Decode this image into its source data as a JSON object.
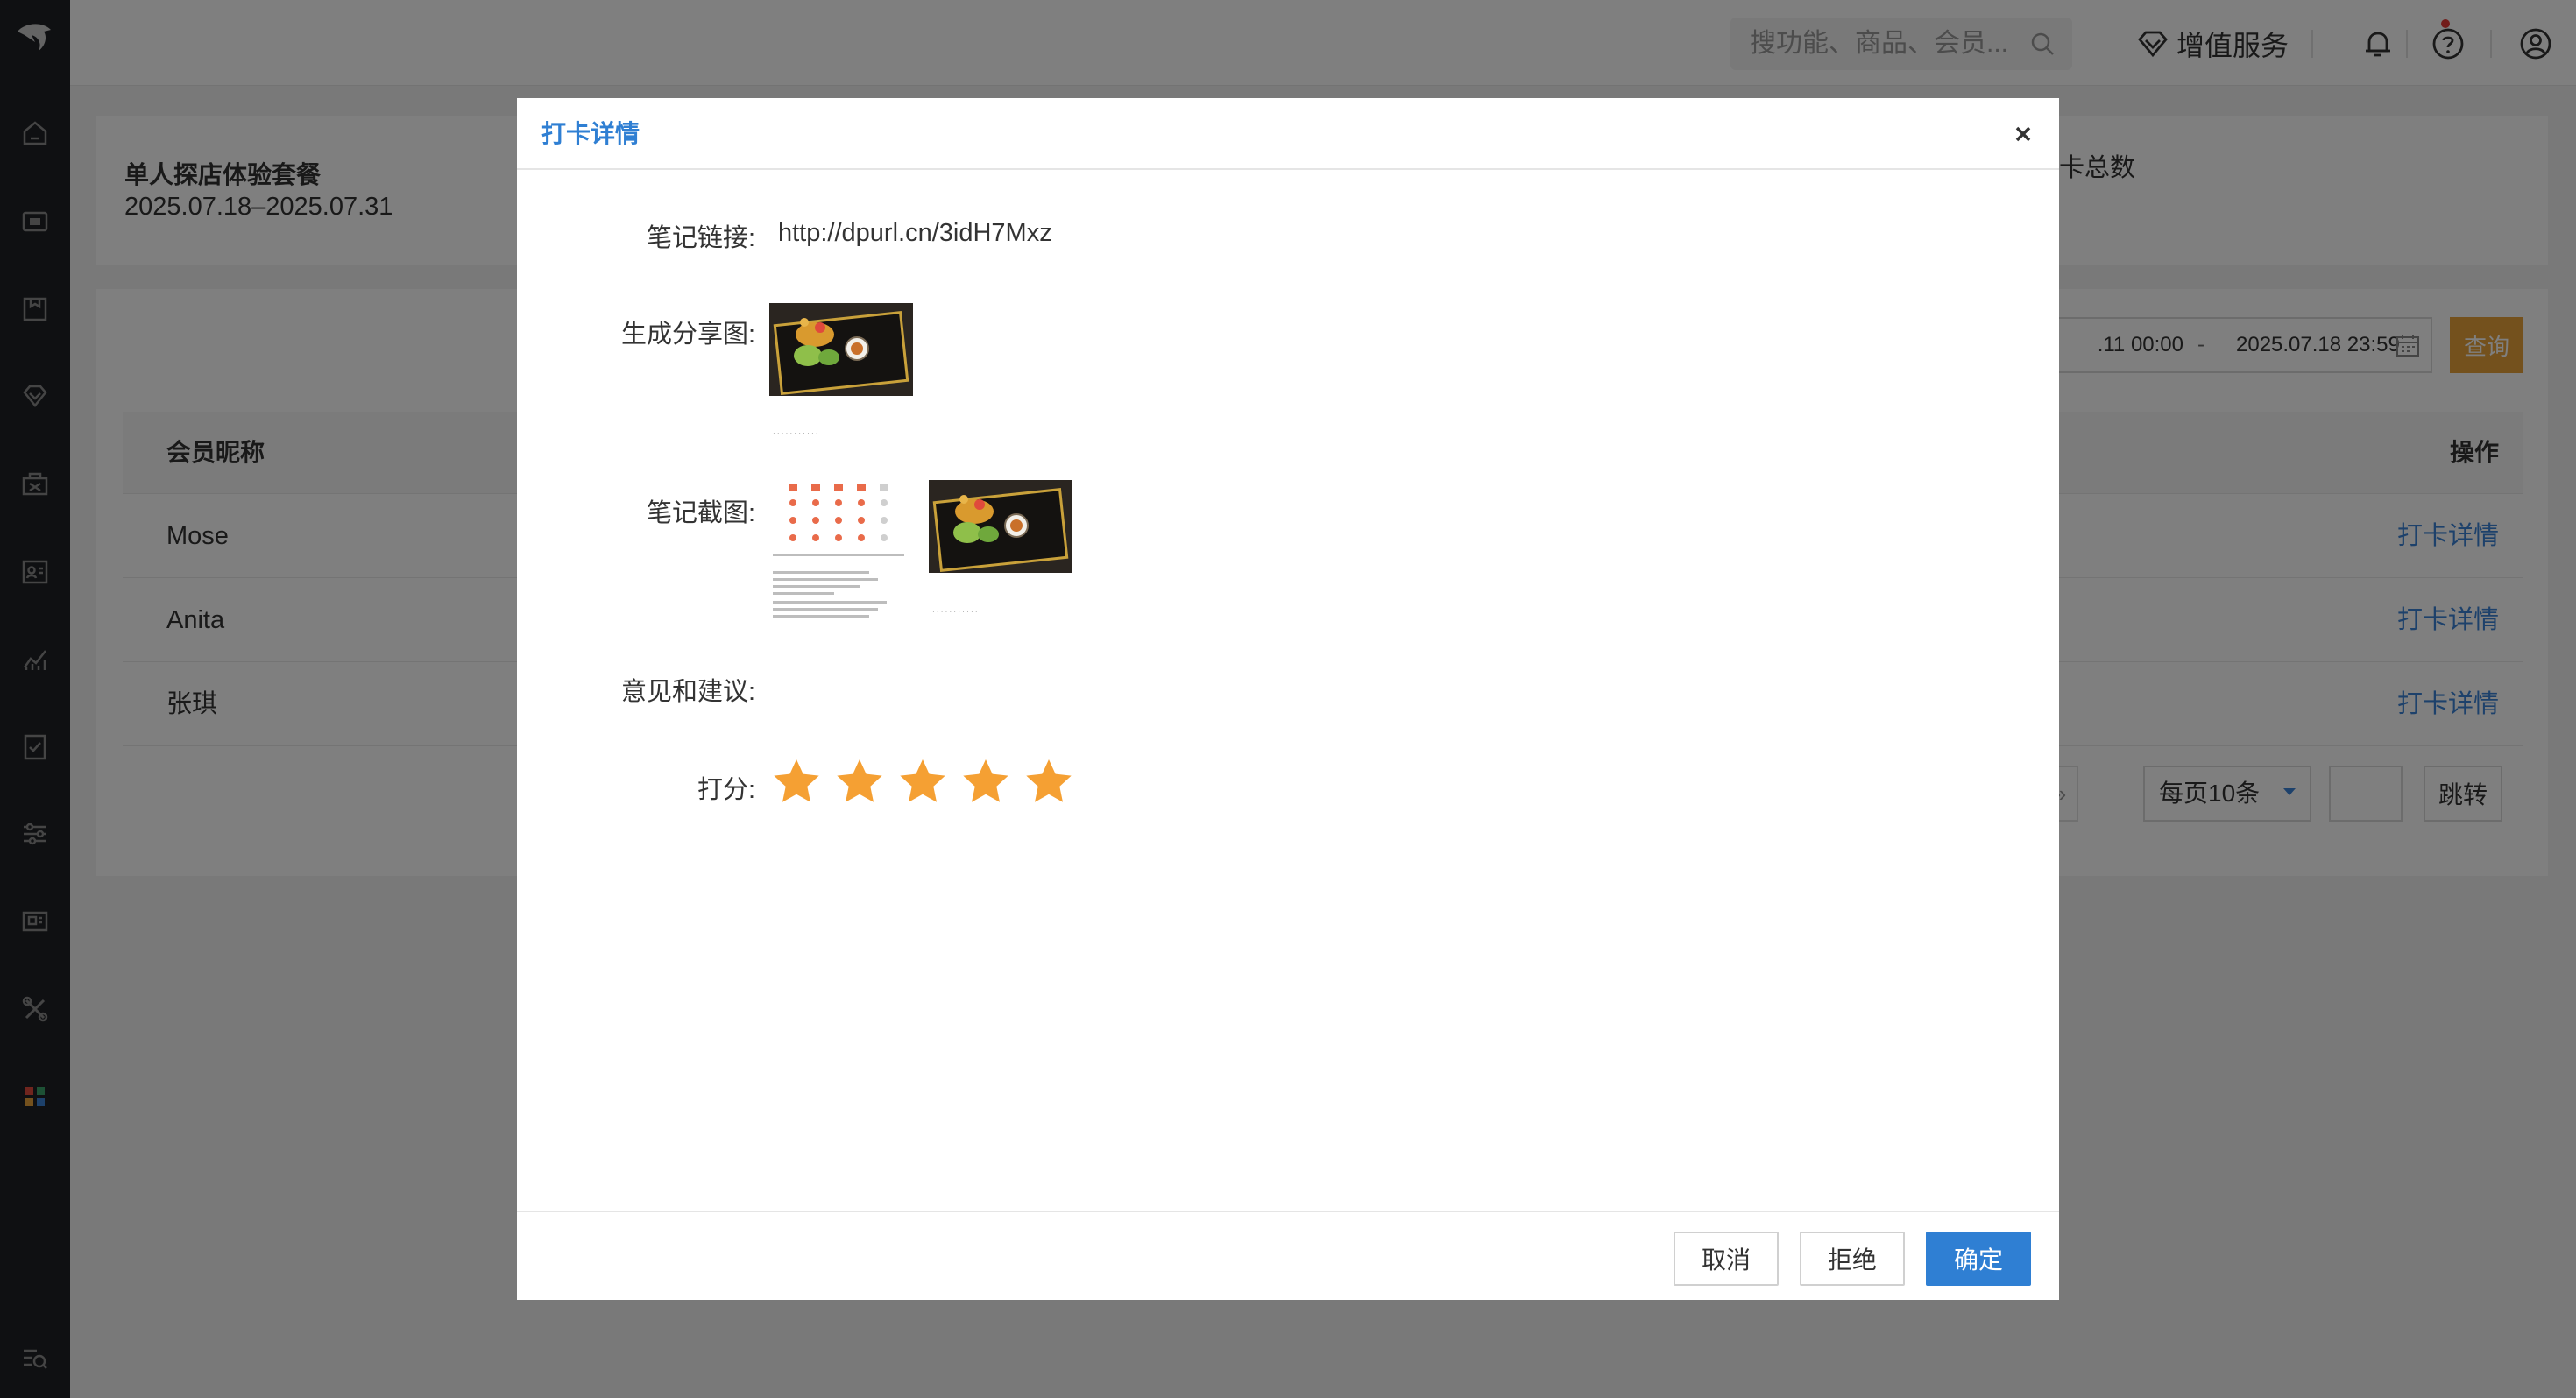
{
  "header": {
    "search_placeholder": "搜功能、商品、会员...",
    "vip_label": "增值服务"
  },
  "summary": {
    "package_title": "单人探店体验套餐",
    "package_dates": "2025.07.18–2025.07.31",
    "stat_label": "卡总数"
  },
  "filter": {
    "date_start": ".11 00:00",
    "date_sep": "-",
    "date_end": "2025.07.18 23:59",
    "query_label": "查询"
  },
  "table": {
    "col_nickname": "会员昵称",
    "col_action": "操作",
    "rows": [
      {
        "name": "Mose",
        "action": "打卡详情"
      },
      {
        "name": "Anita",
        "action": "打卡详情"
      },
      {
        "name": "张琪",
        "action": "打卡详情"
      }
    ]
  },
  "pagination": {
    "next_symbol": "»",
    "page_size_label": "每页10条",
    "jump_label": "跳转"
  },
  "modal": {
    "title": "打卡详情",
    "link_label": "笔记链接:",
    "link_value": "http://dpurl.cn/3idH7Mxz",
    "share_label": "生成分享图:",
    "screenshot_label": "笔记截图:",
    "feedback_label": "意见和建议:",
    "score_label": "打分:",
    "score": 5,
    "score_max": 5,
    "cancel_label": "取消",
    "reject_label": "拒绝",
    "ok_label": "确定"
  },
  "colors": {
    "accent_blue": "#2f7fd3",
    "link_blue": "#3b82d6",
    "star_orange": "#f5a033",
    "query_gold": "#e8a33b",
    "sidebar_bg": "#1f2124"
  }
}
